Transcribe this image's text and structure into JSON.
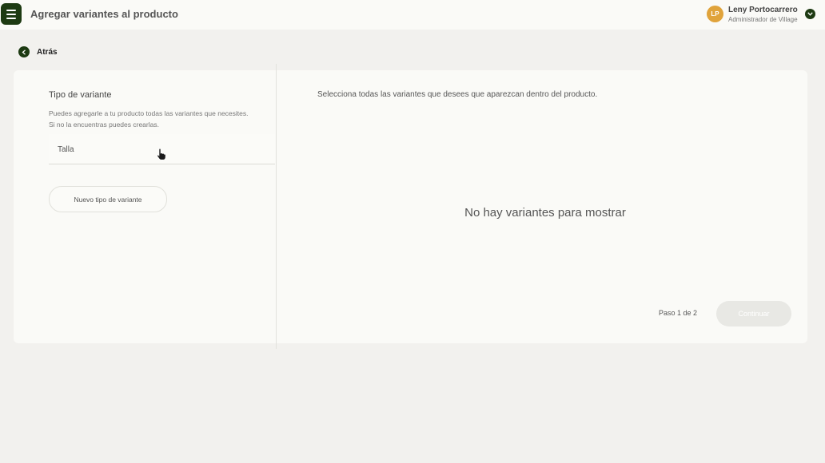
{
  "header": {
    "title": "Agregar variantes al producto",
    "menu_icon": "hamburger-menu-icon"
  },
  "user": {
    "initials": "LP",
    "name": "Leny Portocarrero",
    "role": "Administrador de Village",
    "avatar_color": "#e0a33b"
  },
  "nav": {
    "back_label": "Atrás"
  },
  "left_panel": {
    "title": "Tipo de variante",
    "description": "Puedes agregarle a tu producto todas las variantes que necesites. Si no la encuentras puedes crearlas.",
    "variant_types": [
      "Talla"
    ],
    "new_type_button": "Nuevo tipo de variante"
  },
  "right_panel": {
    "instruction": "Selecciona todas las variantes que desees que aparezcan dentro del producto.",
    "empty_message": "No hay variantes para mostrar",
    "step_label": "Paso 1 de 2",
    "continue_button": "Continuar"
  },
  "colors": {
    "brand": "#1d3a12",
    "background": "#f2f1ee",
    "card": "#fafaf7",
    "disabled_button": "#e8e8e4"
  }
}
